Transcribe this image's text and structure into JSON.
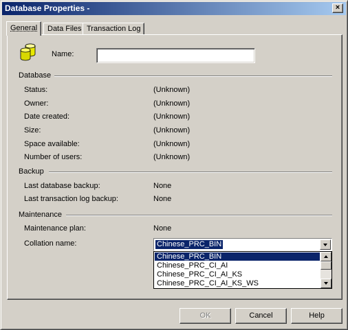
{
  "window": {
    "title": "Database Properties -",
    "close_glyph": "×"
  },
  "tabs": [
    {
      "label": "General",
      "active": true
    },
    {
      "label": "Data Files",
      "active": false
    },
    {
      "label": "Transaction Log",
      "active": false
    }
  ],
  "general": {
    "icon": "database-icon",
    "name_label": "Name:",
    "name_value": ""
  },
  "database": {
    "heading": "Database",
    "rows": [
      {
        "label": "Status:",
        "value": "(Unknown)"
      },
      {
        "label": "Owner:",
        "value": "(Unknown)"
      },
      {
        "label": "Date created:",
        "value": "(Unknown)"
      },
      {
        "label": "Size:",
        "value": "(Unknown)"
      },
      {
        "label": "Space available:",
        "value": "(Unknown)"
      },
      {
        "label": "Number of users:",
        "value": "(Unknown)"
      }
    ]
  },
  "backup": {
    "heading": "Backup",
    "rows": [
      {
        "label": "Last database backup:",
        "value": "None"
      },
      {
        "label": "Last transaction log backup:",
        "value": "None"
      }
    ]
  },
  "maintenance": {
    "heading": "Maintenance",
    "plan_label": "Maintenance plan:",
    "plan_value": "None",
    "collation_label": "Collation name:",
    "collation_value": "Chinese_PRC_BIN",
    "collation_options": [
      "Chinese_PRC_BIN",
      "Chinese_PRC_CI_AI",
      "Chinese_PRC_CI_AI_KS",
      "Chinese_PRC_CI_AI_KS_WS"
    ],
    "selected_index": 0
  },
  "buttons": {
    "ok": "OK",
    "cancel": "Cancel",
    "help": "Help"
  },
  "colors": {
    "titlebar_start": "#0a246a",
    "titlebar_end": "#a6caf0",
    "selection": "#0a246a",
    "face": "#d4d0c8"
  }
}
